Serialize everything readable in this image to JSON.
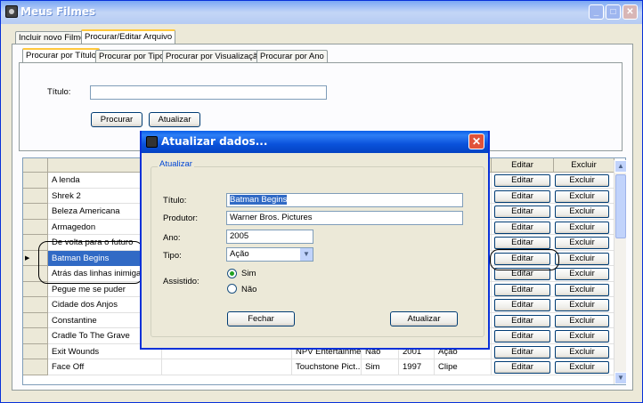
{
  "window": {
    "title": "Meus Filmes",
    "min_label": "_",
    "max_label": "□",
    "close_label": "✕"
  },
  "main_tabs": [
    "Incluir novo Filme",
    "Procurar/Editar Arquivo"
  ],
  "search_tabs": [
    "Procurar por Título",
    "Procurar por Tipo",
    "Procurar por Visualização",
    "Procurar por Ano"
  ],
  "search": {
    "label": "Título:",
    "value": "",
    "search_button": "Procurar",
    "refresh_button": "Atualizar"
  },
  "grid": {
    "edit_header": "Editar",
    "delete_header": "Excluir",
    "edit_label": "Editar",
    "delete_label": "Excluir",
    "current_row_marker": "▶",
    "rows": [
      {
        "title": "A lenda",
        "producer": "",
        "watched": "",
        "year": "",
        "type": ""
      },
      {
        "title": "Shrek 2",
        "producer": "",
        "watched": "",
        "year": "",
        "type": ""
      },
      {
        "title": "Beleza Americana",
        "producer": "",
        "watched": "",
        "year": "",
        "type": ""
      },
      {
        "title": "Armagedon",
        "producer": "",
        "watched": "",
        "year": "",
        "type": ""
      },
      {
        "title": "De volta para o futuro",
        "producer": "",
        "watched": "",
        "year": "",
        "type": ""
      },
      {
        "title": "Batman Begins",
        "producer": "",
        "watched": "",
        "year": "",
        "type": ""
      },
      {
        "title": "Atrás das linhas inimigas",
        "producer": "",
        "watched": "",
        "year": "",
        "type": ""
      },
      {
        "title": "Pegue me se puder",
        "producer": "",
        "watched": "",
        "year": "",
        "type": ""
      },
      {
        "title": "Cidade dos Anjos",
        "producer": "",
        "watched": "",
        "year": "",
        "type": ""
      },
      {
        "title": "Constantine",
        "producer": "",
        "watched": "",
        "year": "",
        "type": ""
      },
      {
        "title": "Cradle To The Grave",
        "producer": "",
        "watched": "",
        "year": "",
        "type": ""
      },
      {
        "title": "Exit Wounds",
        "producer": "NPV Entertainment",
        "watched": "Não",
        "year": "2001",
        "type": "Ação"
      },
      {
        "title": "Face Off",
        "producer": "Touchstone Pict...",
        "watched": "Sim",
        "year": "1997",
        "type": "Clipe"
      }
    ],
    "scroll_up": "▲",
    "scroll_down": "▼"
  },
  "dialog": {
    "title": "Atualizar dados...",
    "close_label": "✕",
    "group_label": "Atualizar",
    "title_label": "Título:",
    "title_value": "Batman Begins",
    "producer_label": "Produtor:",
    "producer_value": "Warner Bros. Pictures",
    "year_label": "Ano:",
    "year_value": "2005",
    "type_label": "Tipo:",
    "type_value": "Ação",
    "type_arrow": "▼",
    "watched_label": "Assistido:",
    "watched_yes": "Sim",
    "watched_no": "Não",
    "close_button": "Fechar",
    "update_button": "Atualizar"
  }
}
